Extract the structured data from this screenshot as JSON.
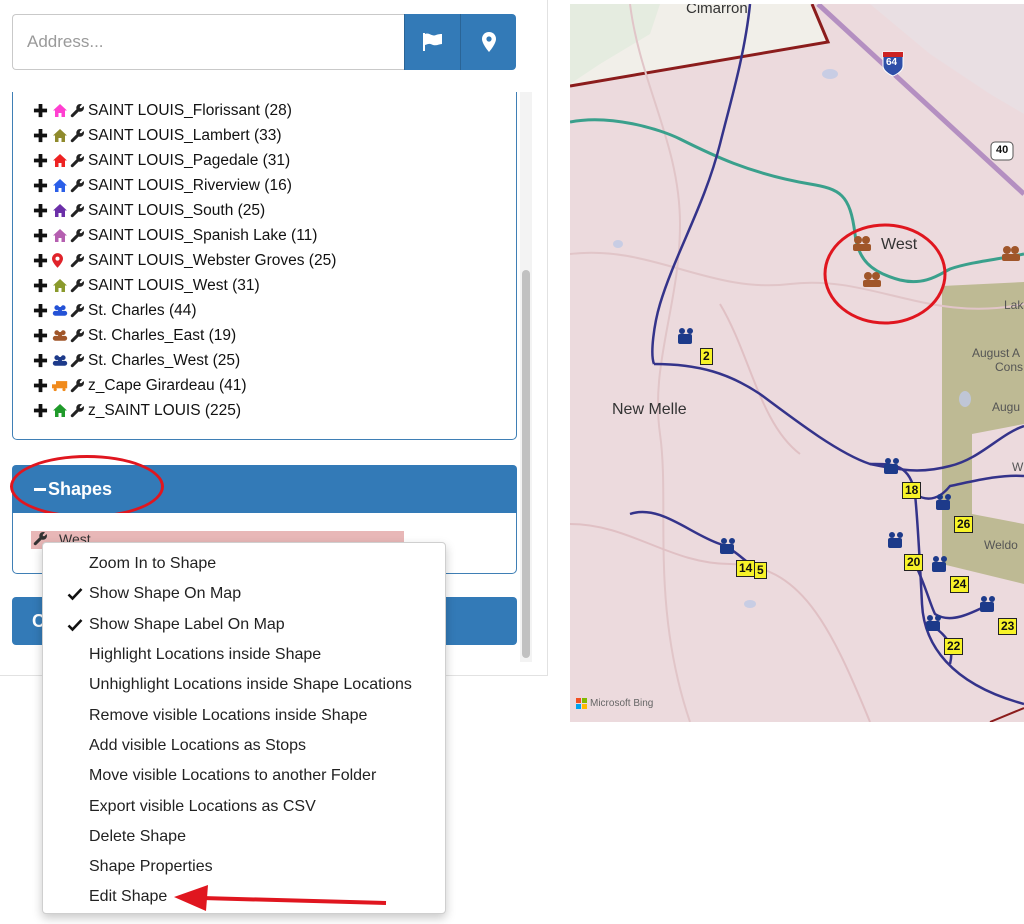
{
  "address": {
    "placeholder": "Address..."
  },
  "folders": [
    {
      "name": "SAINT LOUIS_Florissant (28)",
      "icon": "home-icon",
      "color": "#ff3fd0"
    },
    {
      "name": "SAINT LOUIS_Lambert (33)",
      "icon": "home-icon",
      "color": "#8f8a2c"
    },
    {
      "name": "SAINT LOUIS_Pagedale (31)",
      "icon": "home-icon",
      "color": "#ee2222"
    },
    {
      "name": "SAINT LOUIS_Riverview (16)",
      "icon": "home-icon",
      "color": "#2b5fe8"
    },
    {
      "name": "SAINT LOUIS_South (25)",
      "icon": "home-icon",
      "color": "#6b2fa8"
    },
    {
      "name": "SAINT LOUIS_Spanish Lake (11)",
      "icon": "home-icon",
      "color": "#b55fb0"
    },
    {
      "name": "SAINT LOUIS_Webster Groves (25)",
      "icon": "map-pin-icon",
      "color": "#e0232a"
    },
    {
      "name": "SAINT LOUIS_West (31)",
      "icon": "home-icon",
      "color": "#8a9a2c"
    },
    {
      "name": "St. Charles (44)",
      "icon": "group-icon",
      "color": "#2452d6"
    },
    {
      "name": "St. Charles_East (19)",
      "icon": "group-icon",
      "color": "#a0562a"
    },
    {
      "name": "St. Charles_West (25)",
      "icon": "group-icon",
      "color": "#1d3a8a"
    },
    {
      "name": "z_Cape Girardeau (41)",
      "icon": "truck-icon",
      "color": "#f08a1c"
    },
    {
      "name": "z_SAINT LOUIS (225)",
      "icon": "home-icon",
      "color": "#1f9a2a"
    }
  ],
  "shapes": {
    "header": "Shapes",
    "item": "West"
  },
  "lower_button": {
    "label": "C"
  },
  "map": {
    "labels": {
      "cimarron": "Cimarron",
      "new_melle": "New Melle",
      "west": "West",
      "august_a": "August A",
      "cons": "Cons",
      "augu": "Augu",
      "lak": "Lak",
      "weldo": "Weldo",
      "w": "W"
    },
    "shields": {
      "i64": "64",
      "r40": "40"
    },
    "badges": [
      "2",
      "18",
      "26",
      "20",
      "24",
      "14",
      "5",
      "23",
      "22"
    ],
    "attribution": "Microsoft Bing"
  },
  "context_menu": {
    "items": [
      {
        "label": "Zoom In to Shape",
        "checked": false
      },
      {
        "label": "Show Shape On Map",
        "checked": true
      },
      {
        "label": "Show Shape Label On Map",
        "checked": true
      },
      {
        "label": "Highlight Locations inside Shape",
        "checked": false
      },
      {
        "label": "Unhighlight Locations inside Shape Locations",
        "checked": false
      },
      {
        "label": "Remove visible Locations inside Shape",
        "checked": false
      },
      {
        "label": "Add visible Locations as Stops",
        "checked": false
      },
      {
        "label": "Move visible Locations to another Folder",
        "checked": false
      },
      {
        "label": "Export visible Locations as CSV",
        "checked": false
      },
      {
        "label": "Delete Shape",
        "checked": false
      },
      {
        "label": "Shape Properties",
        "checked": false
      },
      {
        "label": "Edit Shape",
        "checked": false
      }
    ]
  },
  "colors": {
    "accent": "#337ab7",
    "highlight": "#e0161f",
    "route": "#34338a",
    "boundary": "#3aa08c",
    "badge": "#f7f328"
  }
}
